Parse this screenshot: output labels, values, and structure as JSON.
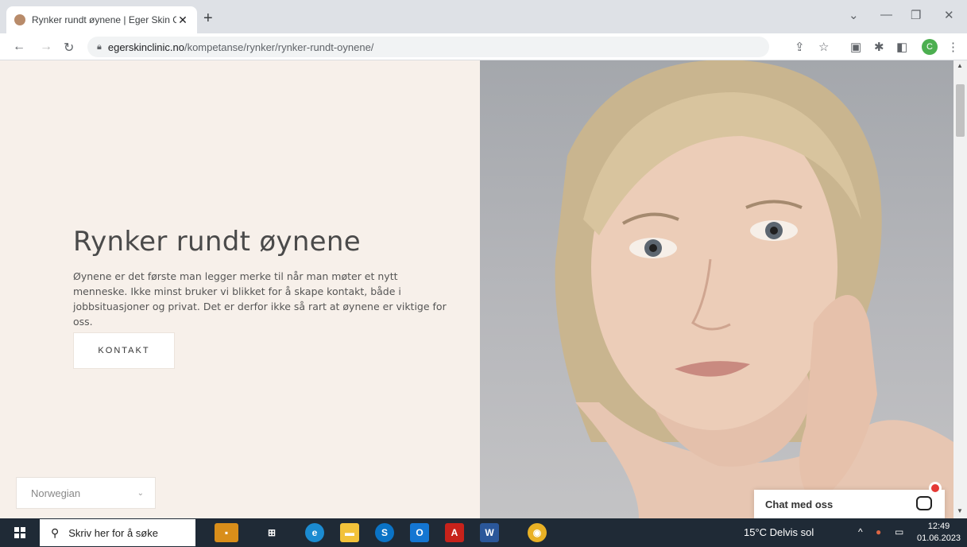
{
  "browser": {
    "tab_title": "Rynker rundt øynene | Eger Skin C",
    "tab_close": "✕",
    "new_tab": "+",
    "url_domain": "egerskinclinic.no",
    "url_path": "/kompetanse/rynker/rynker-rundt-oynene/",
    "profile_initial": "C"
  },
  "page": {
    "title": "Rynker rundt øynene",
    "intro": "Øynene er det første man legger merke til når man møter et nytt menneske. Ikke minst bruker vi blikket for å skape kontakt, både i jobbsituasjoner og privat. Det er derfor ikke så rart at øynene er viktige for oss.",
    "contact_button": "KONTAKT",
    "language_select": "Norwegian",
    "chat_label": "Chat med oss"
  },
  "taskbar": {
    "search_placeholder": "Skriv her for å søke",
    "weather": "15°C  Delvis sol",
    "time": "12:49",
    "date": "01.06.2023"
  },
  "colors": {
    "left_panel": "#f7f0ea",
    "taskbar": "#1f2a36"
  }
}
